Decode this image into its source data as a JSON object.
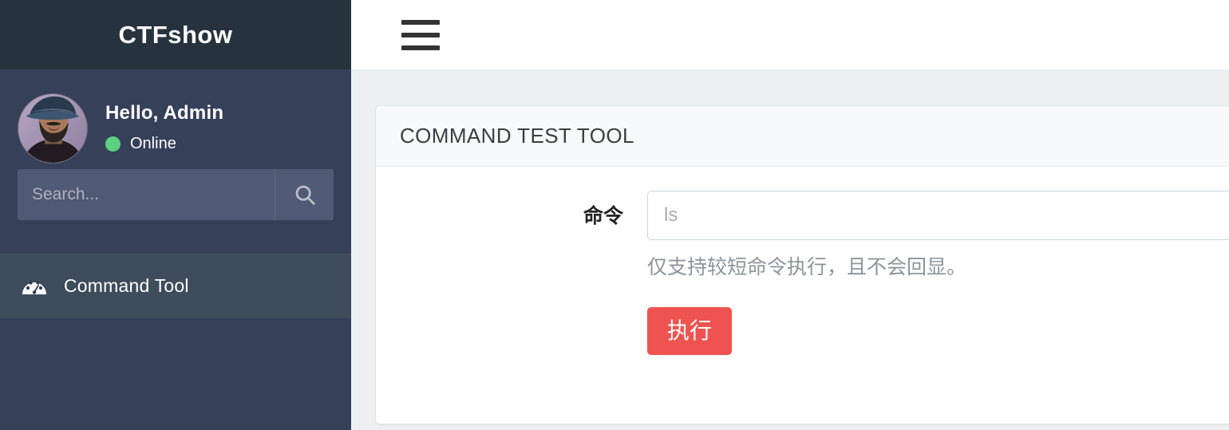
{
  "sidebar": {
    "brand": "CTFshow",
    "user": {
      "greeting": "Hello, Admin",
      "status": "Online",
      "status_color": "#5cd07f",
      "avatar_icon": "user-avatar-portrait"
    },
    "search": {
      "placeholder": "Search...",
      "value": "",
      "button_icon": "search-icon"
    },
    "nav": [
      {
        "label": "Command Tool",
        "icon": "tachometer-icon",
        "active": true
      }
    ]
  },
  "topbar": {
    "menu_toggle_icon": "hamburger-menu-icon"
  },
  "main": {
    "card": {
      "title": "COMMAND TEST TOOL",
      "form": {
        "label": "命令",
        "input_placeholder": "ls",
        "input_value": "",
        "help_text": "仅支持较短命令执行，且不会回显。",
        "submit_label": "执行",
        "submit_color": "#ef5350"
      }
    }
  }
}
